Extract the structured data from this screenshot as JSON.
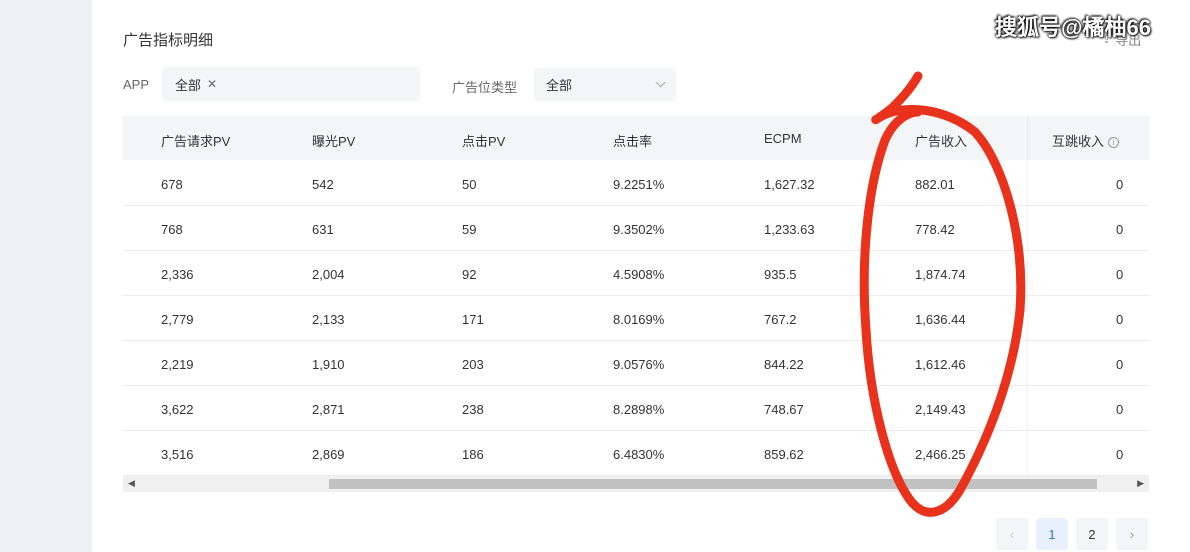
{
  "watermark": "搜狐号@橘柚66",
  "title": "广告指标明细",
  "export_label": "导出",
  "filters": {
    "app_label": "APP",
    "app_tag": "全部",
    "slot_type_label": "广告位类型",
    "slot_type_value": "全部"
  },
  "columns": [
    "广告请求PV",
    "曝光PV",
    "点击PV",
    "点击率",
    "ECPM",
    "广告收入",
    "互跳收入"
  ],
  "rows": [
    [
      "678",
      "542",
      "50",
      "9.2251%",
      "1,627.32",
      "882.01",
      "0"
    ],
    [
      "768",
      "631",
      "59",
      "9.3502%",
      "1,233.63",
      "778.42",
      "0"
    ],
    [
      "2,336",
      "2,004",
      "92",
      "4.5908%",
      "935.5",
      "1,874.74",
      "0"
    ],
    [
      "2,779",
      "2,133",
      "171",
      "8.0169%",
      "767.2",
      "1,636.44",
      "0"
    ],
    [
      "2,219",
      "1,910",
      "203",
      "9.0576%",
      "844.22",
      "1,612.46",
      "0"
    ],
    [
      "3,622",
      "2,871",
      "238",
      "8.2898%",
      "748.67",
      "2,149.43",
      "0"
    ],
    [
      "3,516",
      "2,869",
      "186",
      "6.4830%",
      "859.62",
      "2,466.25",
      "0"
    ]
  ],
  "pagination": {
    "prev": "‹",
    "pages": [
      "1",
      "2"
    ],
    "current": "1",
    "next": "›"
  },
  "annotation_color": "#e8321c"
}
